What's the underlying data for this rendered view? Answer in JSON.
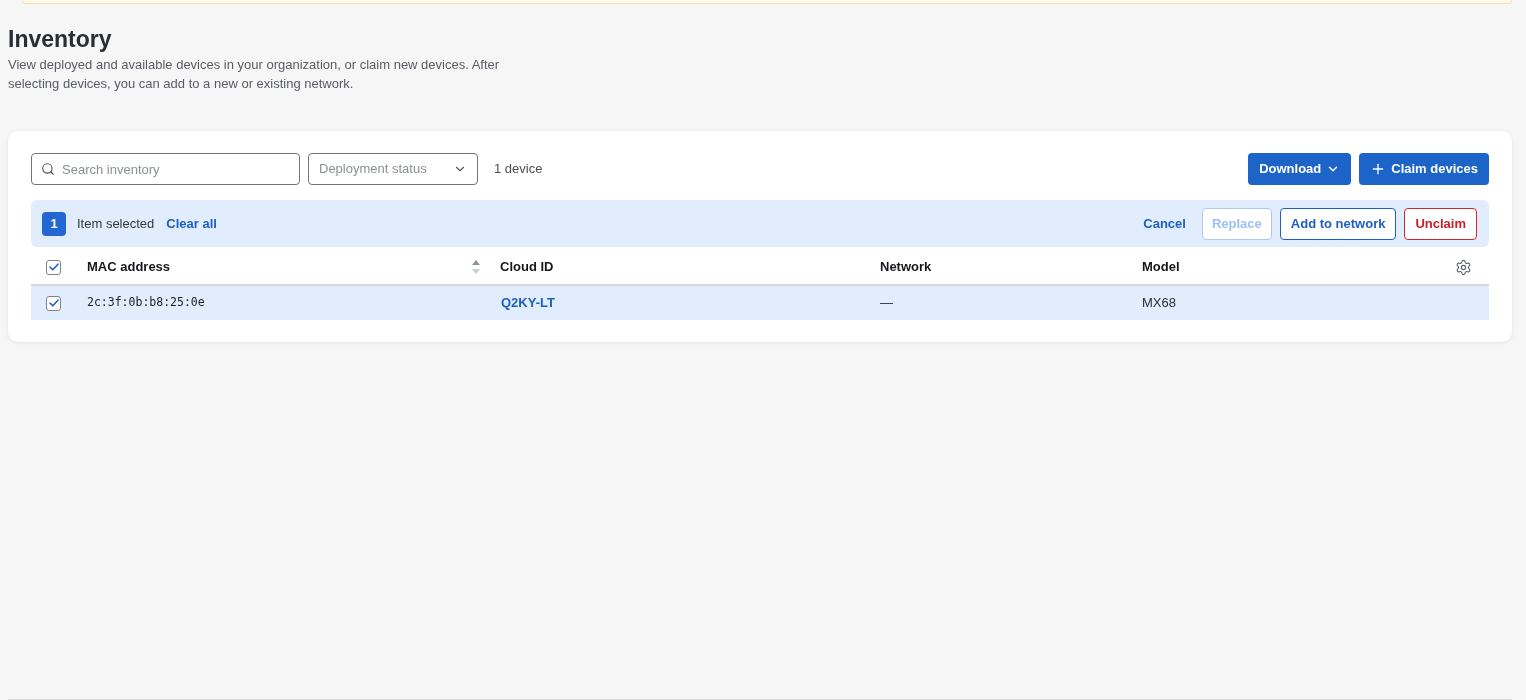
{
  "page": {
    "title": "Inventory",
    "description": "View deployed and available devices in your organization, or claim new devices. After selecting devices, you can add to a new or existing network."
  },
  "toolbar": {
    "search": {
      "placeholder": "Search inventory"
    },
    "filter": {
      "placeholder": "Deployment status"
    },
    "count": "1 device",
    "buttons": [
      {
        "label": "Download",
        "kind": "dropdown"
      },
      {
        "label": "Claim devices",
        "kind": "add"
      }
    ]
  },
  "selection_bar": {
    "count": "1",
    "label": "Item selected",
    "clear": "Clear all",
    "actions": [
      {
        "label": "Cancel",
        "kind": "link",
        "disabled": false
      },
      {
        "label": "Replace",
        "kind": "outline",
        "disabled": true
      },
      {
        "label": "Add to network",
        "kind": "outline",
        "disabled": false
      },
      {
        "label": "Unclaim",
        "kind": "danger",
        "disabled": false
      }
    ]
  },
  "table": {
    "all_checked": true,
    "columns": [
      {
        "label": "MAC address",
        "kind": "sortable"
      },
      {
        "label": "Cloud ID",
        "kind": "plain"
      },
      {
        "label": "Network",
        "kind": "plain"
      },
      {
        "label": "Model",
        "kind": "settings"
      }
    ],
    "rows": [
      {
        "checked": true,
        "selected": true,
        "cells": [
          {
            "text": "2c:3f:0b:b8:25:0e",
            "kind": "mono"
          },
          {
            "text": "Q2KY-LT",
            "kind": "link"
          },
          {
            "text": "—",
            "kind": "text"
          },
          {
            "text": "MX68",
            "kind": "text"
          }
        ]
      }
    ]
  }
}
